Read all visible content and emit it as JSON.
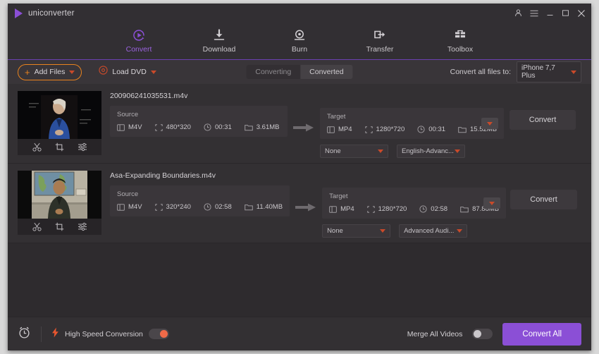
{
  "titlebar": {
    "brand": "uniconverter",
    "controls": [
      {
        "name": "account-icon",
        "label": "account"
      },
      {
        "name": "menu-icon",
        "label": "menu"
      },
      {
        "name": "minimize-button",
        "label": "minimize"
      },
      {
        "name": "maximize-button",
        "label": "maximize"
      },
      {
        "name": "close-button",
        "label": "close"
      }
    ]
  },
  "nav": {
    "items": [
      {
        "label": "Convert",
        "icon": "convert-icon",
        "active": true
      },
      {
        "label": "Download",
        "icon": "download-icon",
        "active": false
      },
      {
        "label": "Burn",
        "icon": "burn-icon",
        "active": false
      },
      {
        "label": "Transfer",
        "icon": "transfer-icon",
        "active": false
      },
      {
        "label": "Toolbox",
        "icon": "toolbox-icon",
        "active": false
      }
    ],
    "accent": "#9b63e0",
    "underline": "#6b3fb0"
  },
  "toolbar": {
    "add_files_label": "Add Files",
    "add_files_border": "#e8821e",
    "load_dvd_label": "Load DVD",
    "segments": [
      {
        "label": "Converting",
        "active": true
      },
      {
        "label": "Converted",
        "active": false
      }
    ],
    "convert_all_to_label": "Convert all files to:",
    "convert_all_to_value": "iPhone 7,7 Plus"
  },
  "files": [
    {
      "filename": "200906241035531.m4v",
      "thumbnail": "woman-in-blue-speaking",
      "tools": [
        "trim-icon",
        "crop-icon",
        "effect-icon"
      ],
      "source": {
        "title": "Source",
        "format": "M4V",
        "resolution": "480*320",
        "duration": "00:31",
        "size": "3.61MB"
      },
      "target": {
        "title": "Target",
        "format": "MP4",
        "resolution": "1280*720",
        "duration": "00:31",
        "size": "15.52MB"
      },
      "subtitle_value": "None",
      "audio_value": "English-Advanc...",
      "convert_label": "Convert"
    },
    {
      "filename": "Asa-Expanding Boundaries.m4v",
      "thumbnail": "person-with-map-background",
      "tools": [
        "trim-icon",
        "crop-icon",
        "effect-icon"
      ],
      "source": {
        "title": "Source",
        "format": "M4V",
        "resolution": "320*240",
        "duration": "02:58",
        "size": "11.40MB"
      },
      "target": {
        "title": "Target",
        "format": "MP4",
        "resolution": "1280*720",
        "duration": "02:58",
        "size": "87.88MB"
      },
      "subtitle_value": "None",
      "audio_value": "Advanced Audi...",
      "convert_label": "Convert"
    }
  ],
  "bottombar": {
    "alarm_icon": "alarm-clock-icon",
    "bolt_icon": "lightning-bolt-icon",
    "high_speed_label": "High Speed Conversion",
    "high_speed_on": true,
    "merge_label": "Merge All Videos",
    "merge_on": false,
    "convert_all_label": "Convert All",
    "convert_all_color": "#8b4fd6",
    "toggle_on_color": "#ef6a48"
  }
}
